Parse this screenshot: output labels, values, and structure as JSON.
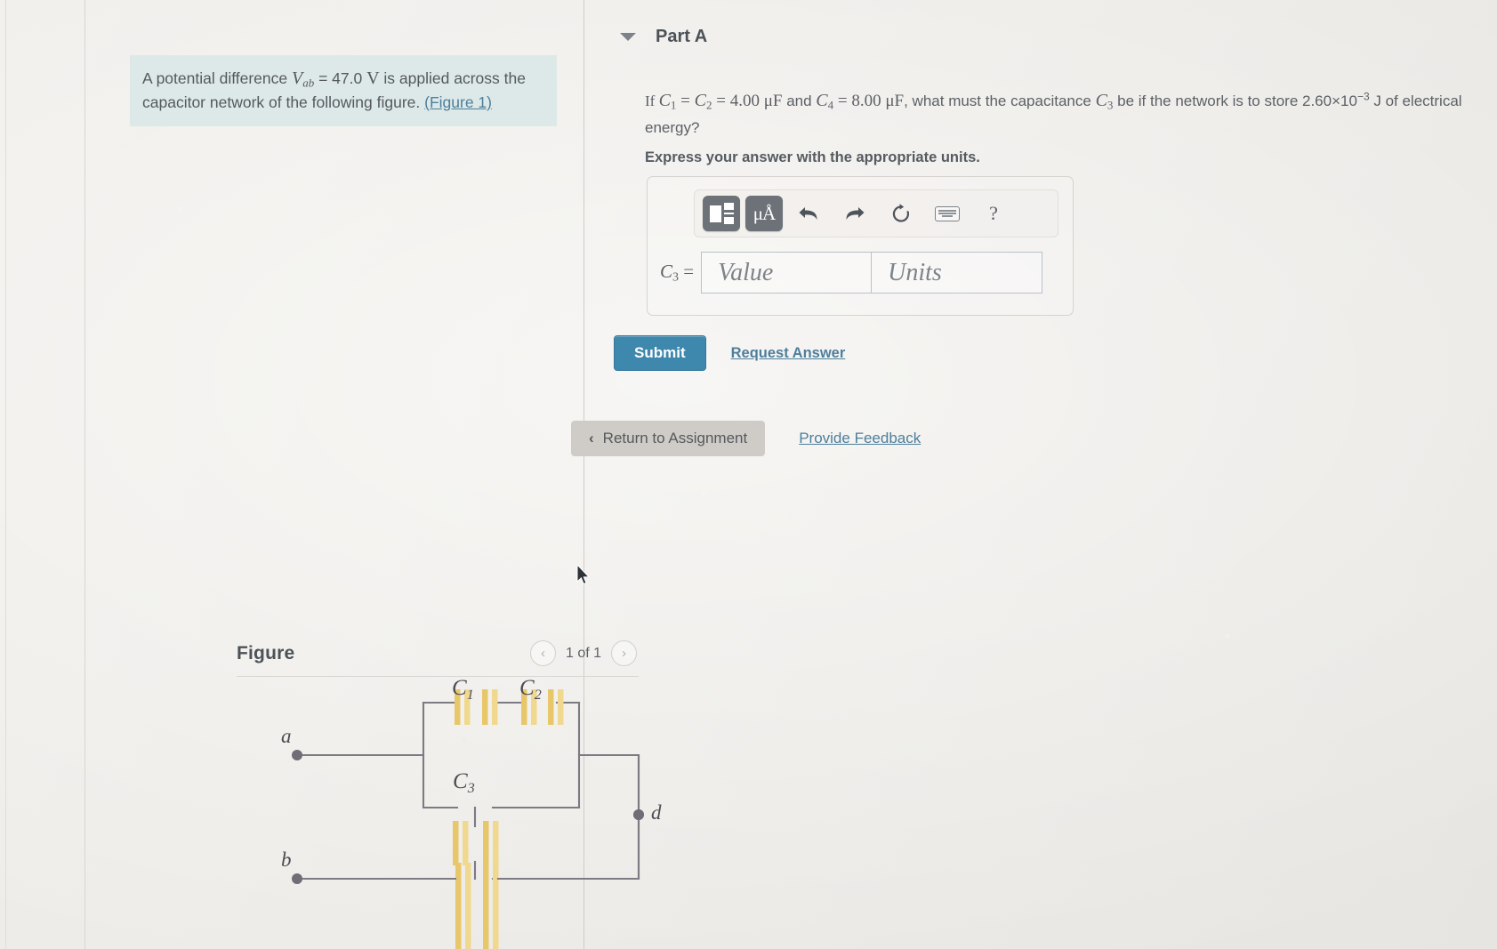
{
  "left_panel": {
    "prompt": {
      "text_before": "A potential difference ",
      "symbol": "V",
      "symbol_sub": "ab",
      "text_mid": " = 47.0 ",
      "unit": "V",
      "text_after": " is applied across the capacitor network of the following figure. ",
      "figure_link": "(Figure 1)"
    },
    "figure": {
      "title": "Figure",
      "pager_count": "1 of 1",
      "prev_icon": "chevron-left-icon",
      "next_icon": "chevron-right-icon",
      "prev_glyph": "‹",
      "next_glyph": "›",
      "labels": {
        "c1": "C",
        "c1_sub": "1",
        "c2": "C",
        "c2_sub": "2",
        "c3": "C",
        "c3_sub": "3",
        "node_a": "a",
        "node_b": "b",
        "node_d": "d"
      },
      "colors": {
        "plate": "#e8c76a",
        "wire": "#7d7a84"
      }
    }
  },
  "right_panel": {
    "part": {
      "caret_icon": "caret-down-icon",
      "title": "Part A"
    },
    "question": {
      "prefix": "If ",
      "c1": "C",
      "c1_sub": "1",
      "eq1": " = ",
      "c2": "C",
      "c2_sub": "2",
      "eq2": " = 4.00 ",
      "unit1": "μF",
      "and": " and ",
      "c4": "C",
      "c4_sub": "4",
      "eq3": " = 8.00 ",
      "unit2": "μF",
      "mid": ", what must the capacitance ",
      "c3": "C",
      "c3_sub": "3",
      "tail": " be if the network is to store 2.60×10",
      "exponent": "−3",
      "tail2": " J of electrical energy?",
      "express": "Express your answer with the appropriate units."
    },
    "answer": {
      "toolbar": [
        {
          "name": "math-template-button",
          "icon": "math-template-icon",
          "label": ""
        },
        {
          "name": "units-button",
          "icon": "micro-angstrom-icon",
          "label": "μÅ"
        },
        {
          "name": "undo-button",
          "icon": "undo-icon",
          "label": "↶"
        },
        {
          "name": "redo-button",
          "icon": "redo-icon",
          "label": "↷"
        },
        {
          "name": "reset-button",
          "icon": "reset-icon",
          "label": "↻"
        },
        {
          "name": "keyboard-button",
          "icon": "keyboard-icon",
          "label": ""
        },
        {
          "name": "help-button",
          "icon": "question-mark-icon",
          "label": "?"
        }
      ],
      "field_label": "C",
      "field_label_sub": "3",
      "field_label_eq": " =",
      "value_placeholder": "Value",
      "units_placeholder": "Units",
      "value": "",
      "units": ""
    },
    "actions": {
      "submit": "Submit",
      "request_answer": "Request Answer",
      "return_to_assignment": "Return to Assignment",
      "return_chevron": "‹",
      "provide_feedback": "Provide Feedback"
    },
    "colors": {
      "submit_bg": "#3e87ad",
      "link": "#4d7f9c",
      "prompt_bg": "#dde9e8",
      "return_bg": "#cfccc7"
    }
  }
}
